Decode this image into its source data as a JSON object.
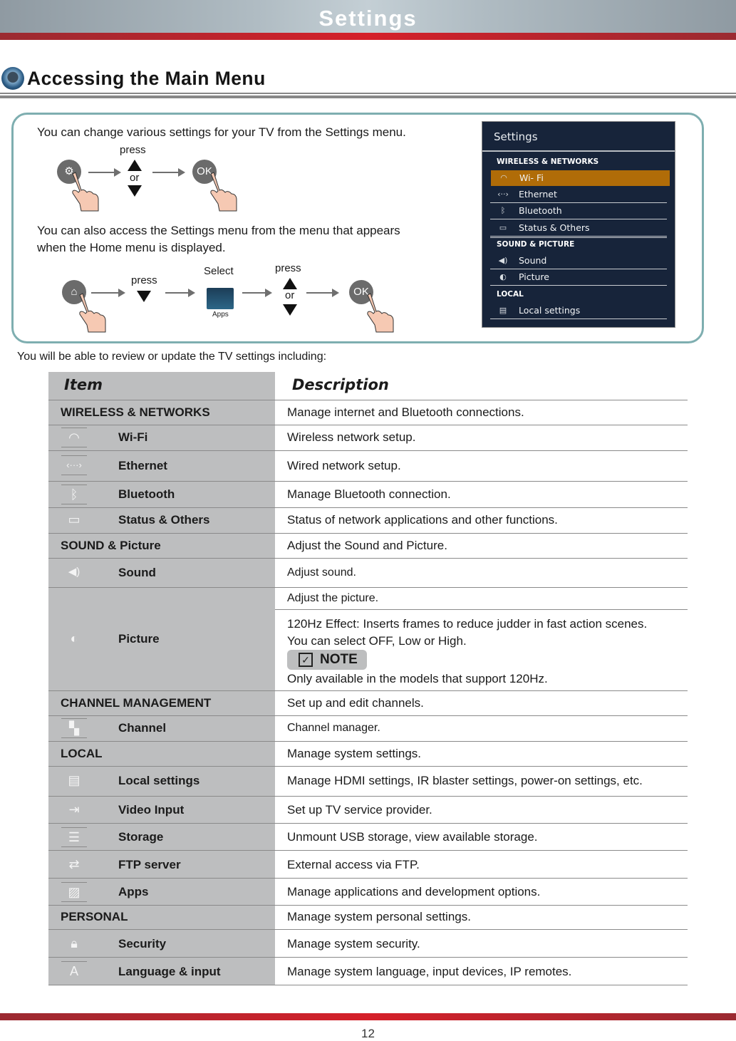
{
  "banner": {
    "title": "Settings"
  },
  "section": {
    "title": "Accessing the Main Menu"
  },
  "intro": {
    "line1": "You can change various settings for your TV from the Settings menu.",
    "line2": "You can also access the Settings menu from the menu that appears",
    "line3": "when the Home menu is displayed."
  },
  "flow1": {
    "start_icon": "gear-icon",
    "press_label": "press",
    "or_label": "or",
    "ok_label": "OK"
  },
  "flow2": {
    "start_icon": "home-icon",
    "press_label": "press",
    "select_label": "Select",
    "apps_label": "Apps",
    "press2_label": "press",
    "or_label": "or",
    "ok_label": "OK"
  },
  "tv_menu": {
    "title": "Settings",
    "accent_color": "#b06c08",
    "sections": [
      {
        "label": "WIRELESS & NETWORKS"
      },
      {
        "label": "SOUND & PICTURE"
      },
      {
        "label": "LOCAL"
      }
    ],
    "items": [
      {
        "label": "Wi- Fi",
        "icon": "wifi-icon",
        "selected": true
      },
      {
        "label": "Ethernet",
        "icon": "ethernet-icon"
      },
      {
        "label": "Bluetooth",
        "icon": "bluetooth-icon"
      },
      {
        "label": "Status & Others",
        "icon": "status-icon"
      },
      {
        "label": "Sound",
        "icon": "sound-icon"
      },
      {
        "label": "Picture",
        "icon": "picture-icon"
      },
      {
        "label": "Local settings",
        "icon": "local-settings-icon"
      }
    ]
  },
  "lead": "You will be able to review or update the TV settings including:",
  "table": {
    "headers": {
      "item": "Item",
      "description": "Description"
    },
    "rows": [
      {
        "type": "category",
        "item": "WIRELESS & NETWORKS",
        "desc": "Manage internet and Bluetooth connections."
      },
      {
        "type": "sub",
        "icon": "wifi-icon",
        "item": "Wi-Fi",
        "desc": "Wireless network setup."
      },
      {
        "type": "sub",
        "icon": "ethernet-icon",
        "item": "Ethernet",
        "desc": "Wired network setup."
      },
      {
        "type": "sub",
        "icon": "bluetooth-icon",
        "item": "Bluetooth",
        "desc": "Manage Bluetooth connection."
      },
      {
        "type": "sub",
        "icon": "status-icon",
        "item": "Status & Others",
        "desc": "Status of network applications and other functions."
      },
      {
        "type": "category",
        "item": "SOUND & Picture",
        "desc": "Adjust the Sound and Picture."
      },
      {
        "type": "sub",
        "icon": "sound-icon",
        "item": "Sound",
        "desc": "Adjust sound."
      },
      {
        "type": "sub",
        "icon": "picture-icon",
        "item": "Picture",
        "desc": "Adjust the picture.",
        "desc2_line1": "120Hz Effect: Inserts frames to reduce judder in fast action scenes.",
        "desc2_line2": "You can select OFF, Low or High.",
        "note_label": "NOTE",
        "note_text": "Only available in the models that support 120Hz."
      },
      {
        "type": "category",
        "item": "CHANNEL MANAGEMENT",
        "desc": "Set up and edit channels."
      },
      {
        "type": "sub",
        "icon": "channel-icon",
        "item": "Channel",
        "desc": "Channel manager."
      },
      {
        "type": "category",
        "item": "LOCAL",
        "desc": "Manage system settings."
      },
      {
        "type": "sub",
        "icon": "local-settings-icon",
        "item": "Local settings",
        "desc": "Manage HDMI settings, IR blaster settings, power-on settings, etc."
      },
      {
        "type": "sub",
        "icon": "video-input-icon",
        "item": "Video Input",
        "desc": "Set up TV service provider."
      },
      {
        "type": "sub",
        "icon": "storage-icon",
        "item": "Storage",
        "desc": "Unmount USB storage, view available storage."
      },
      {
        "type": "sub",
        "icon": "ftp-icon",
        "item": "FTP server",
        "desc": "External access via FTP."
      },
      {
        "type": "sub",
        "icon": "apps-icon",
        "item": "Apps",
        "desc": "Manage applications and development options."
      },
      {
        "type": "category",
        "item": "PERSONAL",
        "desc": "Manage system personal settings."
      },
      {
        "type": "sub",
        "icon": "lock-icon",
        "item": "Security",
        "desc": "Manage system security."
      },
      {
        "type": "sub",
        "icon": "language-icon",
        "item": "Language & input",
        "desc": "Manage system language, input devices, IP remotes."
      }
    ]
  },
  "page_number": "12"
}
